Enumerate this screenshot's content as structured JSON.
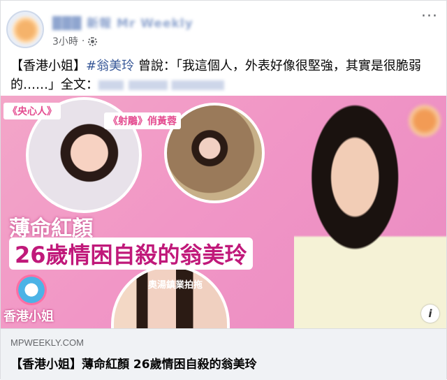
{
  "post": {
    "page_name": "███ 新報 Mr Weekly",
    "time": "3小時",
    "text_prefix": "【香港小姐】",
    "hashtag": "#翁美玲",
    "text_body": " 曾說：「我這個人，外表好像很堅強，其實是很脆弱的……」全文："
  },
  "image": {
    "label_nurse": "《央心人》",
    "label_drama": "《射鵰》俏黃蓉",
    "label_ad": "奧湯鎮業拍拖",
    "headline_line1": "薄命紅顏",
    "headline_line2": "26歲情困自殺的翁美玲",
    "logo_text": "香港小姐",
    "info_icon": "i"
  },
  "link_preview": {
    "domain": "MPWEEKLY.COM",
    "title": "【香港小姐】薄命紅顏 26歲情困自殺的翁美玲"
  },
  "menu": {
    "more": "···"
  }
}
